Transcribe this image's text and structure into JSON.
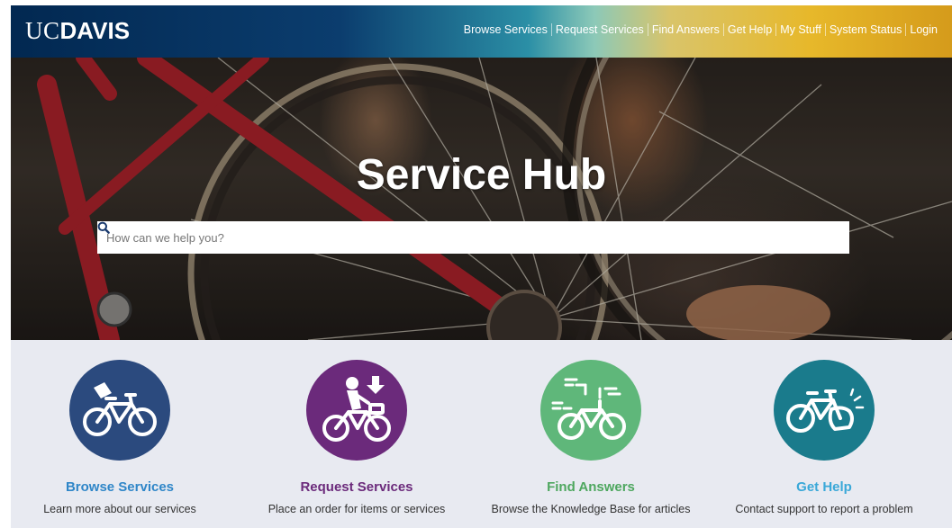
{
  "brand": {
    "logo_uc": "UC",
    "logo_davis": "DAVIS"
  },
  "nav": {
    "items": [
      "Browse Services",
      "Request Services",
      "Find Answers",
      "Get Help",
      "My Stuff",
      "System Status",
      "Login"
    ]
  },
  "hero": {
    "title": "Service Hub",
    "search_placeholder": "How can we help you?",
    "search_icon": "search-icon"
  },
  "tiles": [
    {
      "title": "Browse Services",
      "description": "Learn more about our services",
      "color": "#2b4a7e",
      "title_color": "#2f86c8",
      "icon": "bicycle-tag-icon"
    },
    {
      "title": "Request Services",
      "description": "Place an order for items or services",
      "color": "#6b2a7b",
      "title_color": "#6b2a7b",
      "icon": "cyclist-download-icon"
    },
    {
      "title": "Find Answers",
      "description": "Browse the Knowledge Base for articles",
      "color": "#5fb77a",
      "title_color": "#4ea75f",
      "icon": "bicycle-text-icon"
    },
    {
      "title": "Get Help",
      "description": "Contact support to report a problem",
      "color": "#1a7b8c",
      "title_color": "#3aa8d8",
      "icon": "bicycle-flat-tire-icon"
    }
  ]
}
